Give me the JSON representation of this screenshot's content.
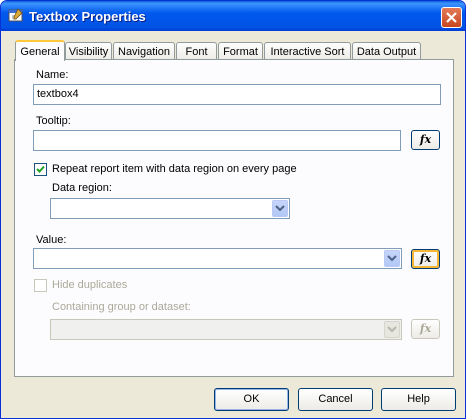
{
  "window": {
    "title": "Textbox Properties"
  },
  "tabs": [
    "General",
    "Visibility",
    "Navigation",
    "Font",
    "Format",
    "Interactive Sort",
    "Data Output"
  ],
  "form": {
    "name_label": "Name:",
    "name_value": "textbox4",
    "tooltip_label": "Tooltip:",
    "tooltip_value": "",
    "repeat_label": "Repeat report item with data region on every page",
    "repeat_checked": true,
    "data_region_label": "Data region:",
    "data_region_value": "",
    "value_label": "Value:",
    "value_value": "",
    "hide_duplicates_label": "Hide duplicates",
    "hide_duplicates_checked": false,
    "containing_group_label": "Containing group or dataset:",
    "containing_group_value": "",
    "fx_label": "fx"
  },
  "buttons": {
    "ok": "OK",
    "cancel": "Cancel",
    "help": "Help"
  },
  "colors": {
    "titlebar": "#0058ee",
    "dialog_bg": "#ece9d8",
    "active_tab_accent": "#ffc83c",
    "input_border": "#7f9db9"
  },
  "icons": {
    "title": "properties-window-icon",
    "close": "close-icon",
    "expression": "fx-icon",
    "dropdown": "chevron-down-icon",
    "check": "checkmark-icon"
  }
}
